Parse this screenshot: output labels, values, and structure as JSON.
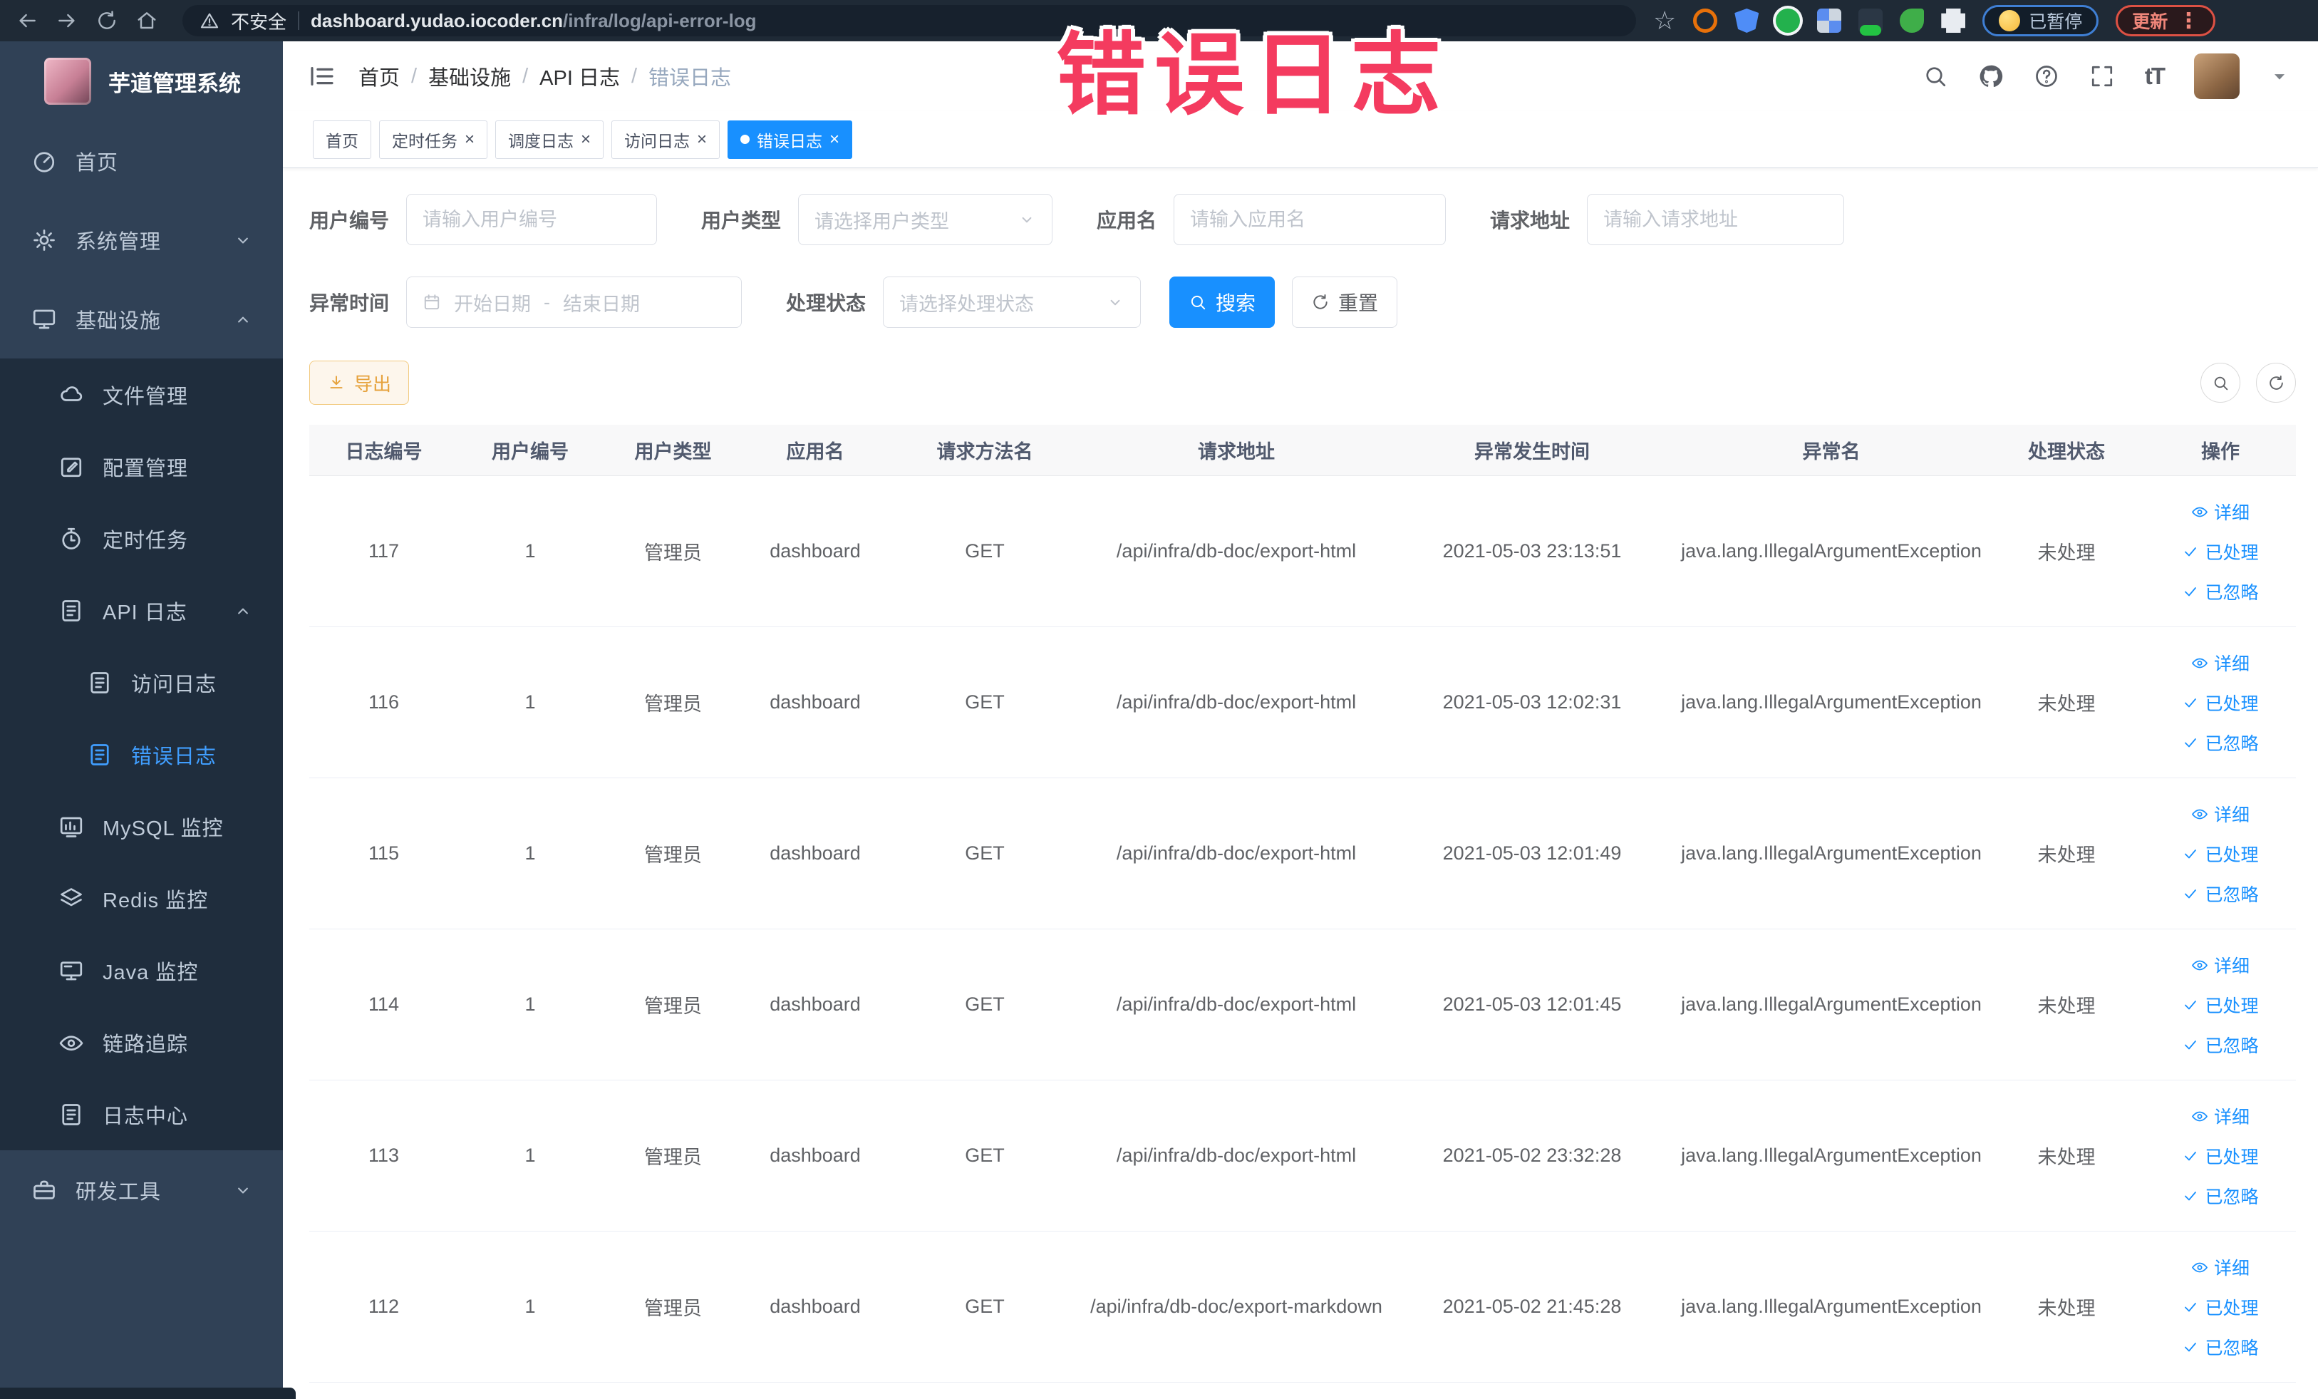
{
  "browser": {
    "security_label": "不安全",
    "url_domain": "dashboard.yudao.iocoder.cn",
    "url_path": "/infra/log/api-error-log",
    "paused_label": "已暂停",
    "update_label": "更新"
  },
  "overlay": {
    "text": "错误日志"
  },
  "sidebar": {
    "title": "芋道管理系统",
    "items": [
      {
        "label": "首页",
        "icon": "gauge",
        "depth": 0
      },
      {
        "label": "系统管理",
        "icon": "gear",
        "depth": 0,
        "arrow": "down"
      },
      {
        "label": "基础设施",
        "icon": "monitor",
        "depth": 0,
        "arrow": "up"
      },
      {
        "label": "文件管理",
        "icon": "cloud",
        "depth": 1
      },
      {
        "label": "配置管理",
        "icon": "edit",
        "depth": 1
      },
      {
        "label": "定时任务",
        "icon": "timer",
        "depth": 1
      },
      {
        "label": "API 日志",
        "icon": "doc",
        "depth": 1,
        "arrow": "up"
      },
      {
        "label": "访问日志",
        "icon": "doc",
        "depth": 2
      },
      {
        "label": "错误日志",
        "icon": "doc",
        "depth": 2,
        "active": true
      },
      {
        "label": "MySQL 监控",
        "icon": "chart",
        "depth": 1
      },
      {
        "label": "Redis 监控",
        "icon": "layers",
        "depth": 1
      },
      {
        "label": "Java 监控",
        "icon": "screen",
        "depth": 1
      },
      {
        "label": "链路追踪",
        "icon": "eye",
        "depth": 1
      },
      {
        "label": "日志中心",
        "icon": "doc",
        "depth": 1
      },
      {
        "label": "研发工具",
        "icon": "toolbox",
        "depth": 0,
        "arrow": "down"
      }
    ]
  },
  "header": {
    "breadcrumb": [
      "首页",
      "基础设施",
      "API 日志",
      "错误日志"
    ],
    "breadcrumb_separator": "/"
  },
  "tabs": [
    {
      "label": "首页",
      "closable": false,
      "active": false
    },
    {
      "label": "定时任务",
      "closable": true,
      "active": false
    },
    {
      "label": "调度日志",
      "closable": true,
      "active": false
    },
    {
      "label": "访问日志",
      "closable": true,
      "active": false
    },
    {
      "label": "错误日志",
      "closable": true,
      "active": true
    }
  ],
  "filters": {
    "user_id": {
      "label": "用户编号",
      "placeholder": "请输入用户编号"
    },
    "user_type": {
      "label": "用户类型",
      "placeholder": "请选择用户类型"
    },
    "app_name": {
      "label": "应用名",
      "placeholder": "请输入应用名"
    },
    "request_url": {
      "label": "请求地址",
      "placeholder": "请输入请求地址"
    },
    "exception_time": {
      "label": "异常时间",
      "start_placeholder": "开始日期",
      "separator": "-",
      "end_placeholder": "结束日期"
    },
    "process_status": {
      "label": "处理状态",
      "placeholder": "请选择处理状态"
    },
    "search_label": "搜索",
    "reset_label": "重置"
  },
  "toolbar": {
    "export_label": "导出"
  },
  "table": {
    "columns": [
      "日志编号",
      "用户编号",
      "用户类型",
      "应用名",
      "请求方法名",
      "请求地址",
      "异常发生时间",
      "异常名",
      "处理状态",
      "操作"
    ],
    "rows": [
      {
        "id": "117",
        "user_id": "1",
        "user_type": "管理员",
        "app_name": "dashboard",
        "method": "GET",
        "url": "/api/infra/db-doc/export-html",
        "time": "2021-05-03 23:13:51",
        "exception": "java.lang.IllegalArgumentException",
        "status": "未处理"
      },
      {
        "id": "116",
        "user_id": "1",
        "user_type": "管理员",
        "app_name": "dashboard",
        "method": "GET",
        "url": "/api/infra/db-doc/export-html",
        "time": "2021-05-03 12:02:31",
        "exception": "java.lang.IllegalArgumentException",
        "status": "未处理"
      },
      {
        "id": "115",
        "user_id": "1",
        "user_type": "管理员",
        "app_name": "dashboard",
        "method": "GET",
        "url": "/api/infra/db-doc/export-html",
        "time": "2021-05-03 12:01:49",
        "exception": "java.lang.IllegalArgumentException",
        "status": "未处理"
      },
      {
        "id": "114",
        "user_id": "1",
        "user_type": "管理员",
        "app_name": "dashboard",
        "method": "GET",
        "url": "/api/infra/db-doc/export-html",
        "time": "2021-05-03 12:01:45",
        "exception": "java.lang.IllegalArgumentException",
        "status": "未处理"
      },
      {
        "id": "113",
        "user_id": "1",
        "user_type": "管理员",
        "app_name": "dashboard",
        "method": "GET",
        "url": "/api/infra/db-doc/export-html",
        "time": "2021-05-02 23:32:28",
        "exception": "java.lang.IllegalArgumentException",
        "status": "未处理"
      },
      {
        "id": "112",
        "user_id": "1",
        "user_type": "管理员",
        "app_name": "dashboard",
        "method": "GET",
        "url": "/api/infra/db-doc/export-markdown",
        "time": "2021-05-02 21:45:28",
        "exception": "java.lang.IllegalArgumentException",
        "status": "未处理"
      }
    ],
    "actions": [
      {
        "label": "详细",
        "icon": "eye"
      },
      {
        "label": "已处理",
        "icon": "check"
      },
      {
        "label": "已忽略",
        "icon": "check"
      }
    ]
  },
  "colors": {
    "accent": "#1890ff",
    "menu_active": "#409eff",
    "sidebar_bg": "#304156",
    "submenu_bg": "#1f2d3d",
    "warning": "#e6a23c",
    "overlay": "#f43b5f"
  }
}
